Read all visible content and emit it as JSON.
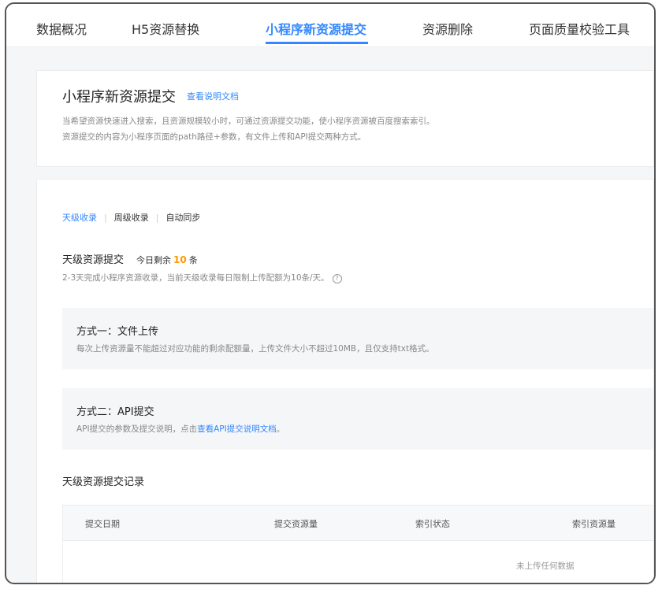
{
  "tabs": [
    {
      "label": "数据概况"
    },
    {
      "label": "H5资源替换"
    },
    {
      "label": "小程序新资源提交",
      "active": true
    },
    {
      "label": "资源删除"
    },
    {
      "label": "页面质量校验工具"
    }
  ],
  "intro": {
    "title": "小程序新资源提交",
    "doc_link": "查看说明文档",
    "desc_line1": "当希望资源快速进入搜索，且资源规模较小时，可通过资源提交功能，使小程序资源被百度搜索索引。",
    "desc_line2": "资源提交的内容为小程序页面的path路径+参数，有文件上传和API提交两种方式。"
  },
  "sub_tabs": [
    {
      "label": "天级收录",
      "active": true
    },
    {
      "label": "周级收录"
    },
    {
      "label": "自动同步"
    }
  ],
  "daily": {
    "title": "天级资源提交",
    "remain_prefix": "今日剩余",
    "remain_count": "10",
    "remain_unit": "条",
    "desc": "2-3天完成小程序资源收录，当前天级收录每日限制上传配额为10条/天。",
    "help_icon": "?"
  },
  "method1": {
    "title": "方式一：文件上传",
    "desc": "每次上传资源量不能超过对应功能的剩余配额量，上传文件大小不超过10MB，且仅支持txt格式。"
  },
  "method2": {
    "title": "方式二：API提交",
    "desc_prefix": "API提交的参数及提交说明，点击",
    "link": "查看API提交说明文档",
    "desc_suffix": "。"
  },
  "records": {
    "title": "天级资源提交记录",
    "columns": [
      "提交日期",
      "提交资源量",
      "索引状态",
      "索引资源量"
    ],
    "empty_text": "未上传任何数据"
  },
  "colors": {
    "accent": "#3388ff",
    "highlight": "#ff9900"
  }
}
